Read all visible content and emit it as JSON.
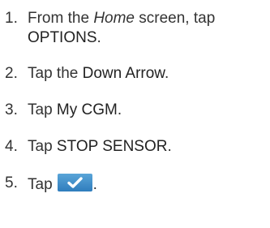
{
  "steps": [
    {
      "number": "1.",
      "parts": [
        "From the ",
        "Home",
        " screen, tap",
        "OPTIONS",
        "."
      ]
    },
    {
      "number": "2.",
      "parts": [
        "Tap the ",
        "Down Arrow",
        "."
      ]
    },
    {
      "number": "3.",
      "parts": [
        "Tap ",
        "My CGM",
        "."
      ]
    },
    {
      "number": "4.",
      "parts": [
        "Tap ",
        "STOP SENSOR",
        "."
      ]
    },
    {
      "number": "5.",
      "parts": [
        "Tap",
        "."
      ],
      "icon": "checkmark-button-icon",
      "button_color": "#3a8ccb"
    }
  ]
}
